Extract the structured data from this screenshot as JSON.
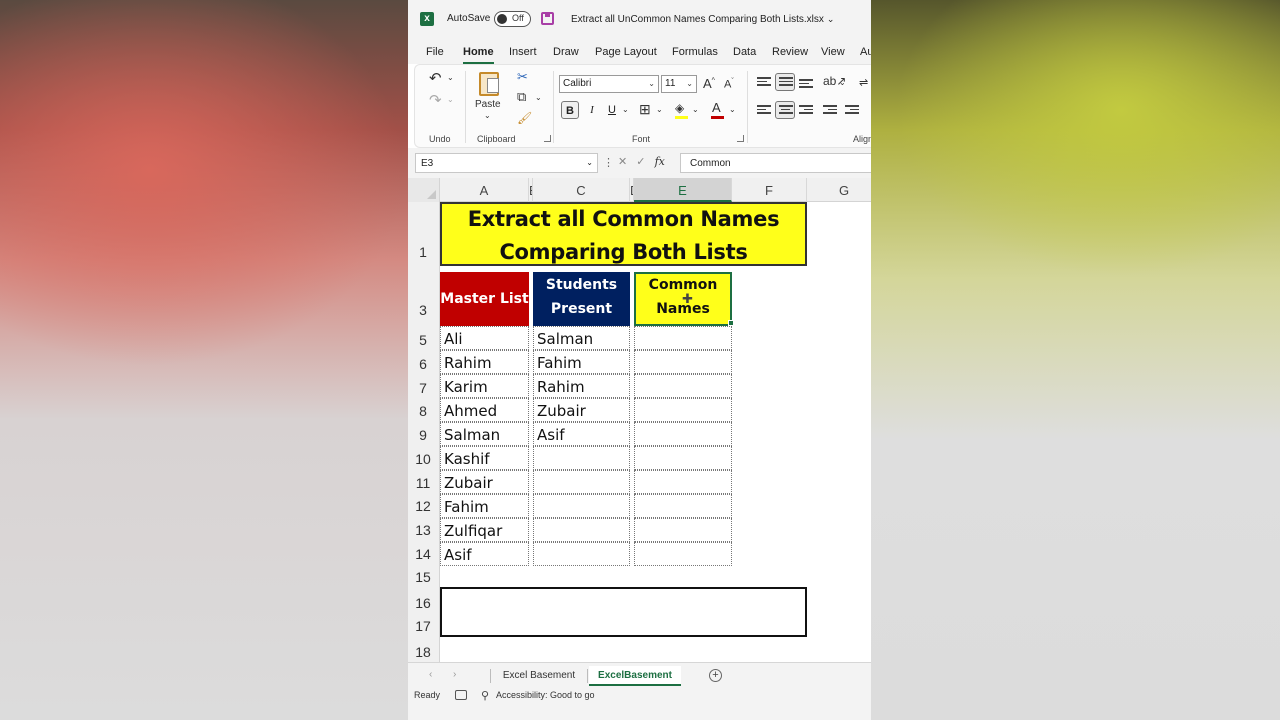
{
  "window": {
    "autosave_label": "AutoSave",
    "autosave_state": "Off",
    "file_title": "Extract all UnCommon Names Comparing Both Lists.xlsx"
  },
  "menu": [
    "File",
    "Home",
    "Insert",
    "Draw",
    "Page Layout",
    "Formulas",
    "Data",
    "Review",
    "View",
    "Au"
  ],
  "menu_active": "Home",
  "ribbon": {
    "paste_label": "Paste",
    "font_name": "Calibri",
    "font_size": "11",
    "bold": "B",
    "italic": "I",
    "underline": "U",
    "grow_font": "A",
    "shrink_font": "A",
    "font_color_glyph": "A",
    "groups": {
      "undo": "Undo",
      "clipboard": "Clipboard",
      "font": "Font",
      "alignment": "Align"
    }
  },
  "formula_bar": {
    "name_box": "E3",
    "fx": "fx",
    "formula": "Common"
  },
  "columns": [
    "A",
    "B",
    "C",
    "D",
    "E",
    "F",
    "G"
  ],
  "selected_column": "E",
  "rows": [
    "1",
    "3",
    "5",
    "6",
    "7",
    "8",
    "9",
    "10",
    "11",
    "12",
    "13",
    "14",
    "15",
    "16",
    "17",
    "18"
  ],
  "sheet": {
    "title_line1": "Extract all Common Names",
    "title_line2": "Comparing Both Lists",
    "header_master": "Master List",
    "header_students_1": "Students",
    "header_students_2": "Present",
    "header_common_1": "Common",
    "header_common_2": "Names",
    "master_list": [
      "Ali",
      "Rahim",
      "Karim",
      "Ahmed",
      "Salman",
      "Kashif",
      "Zubair",
      "Fahim",
      "Zulfiqar",
      "Asif"
    ],
    "students_present": [
      "Salman",
      "Fahim",
      "Rahim",
      "Zubair",
      "Asif",
      "",
      "",
      "",
      "",
      ""
    ],
    "common_names": [
      "",
      "",
      "",
      "",
      "",
      "",
      "",
      "",
      "",
      ""
    ]
  },
  "tabs": [
    "Excel Basement",
    "ExcelBasement"
  ],
  "active_tab": "ExcelBasement",
  "status": {
    "ready": "Ready",
    "accessibility": "Accessibility: Good to go"
  },
  "colors": {
    "excel_green": "#1d6f42",
    "title_yellow": "#ffff1a",
    "master_red": "#c00000",
    "students_navy": "#002060"
  }
}
